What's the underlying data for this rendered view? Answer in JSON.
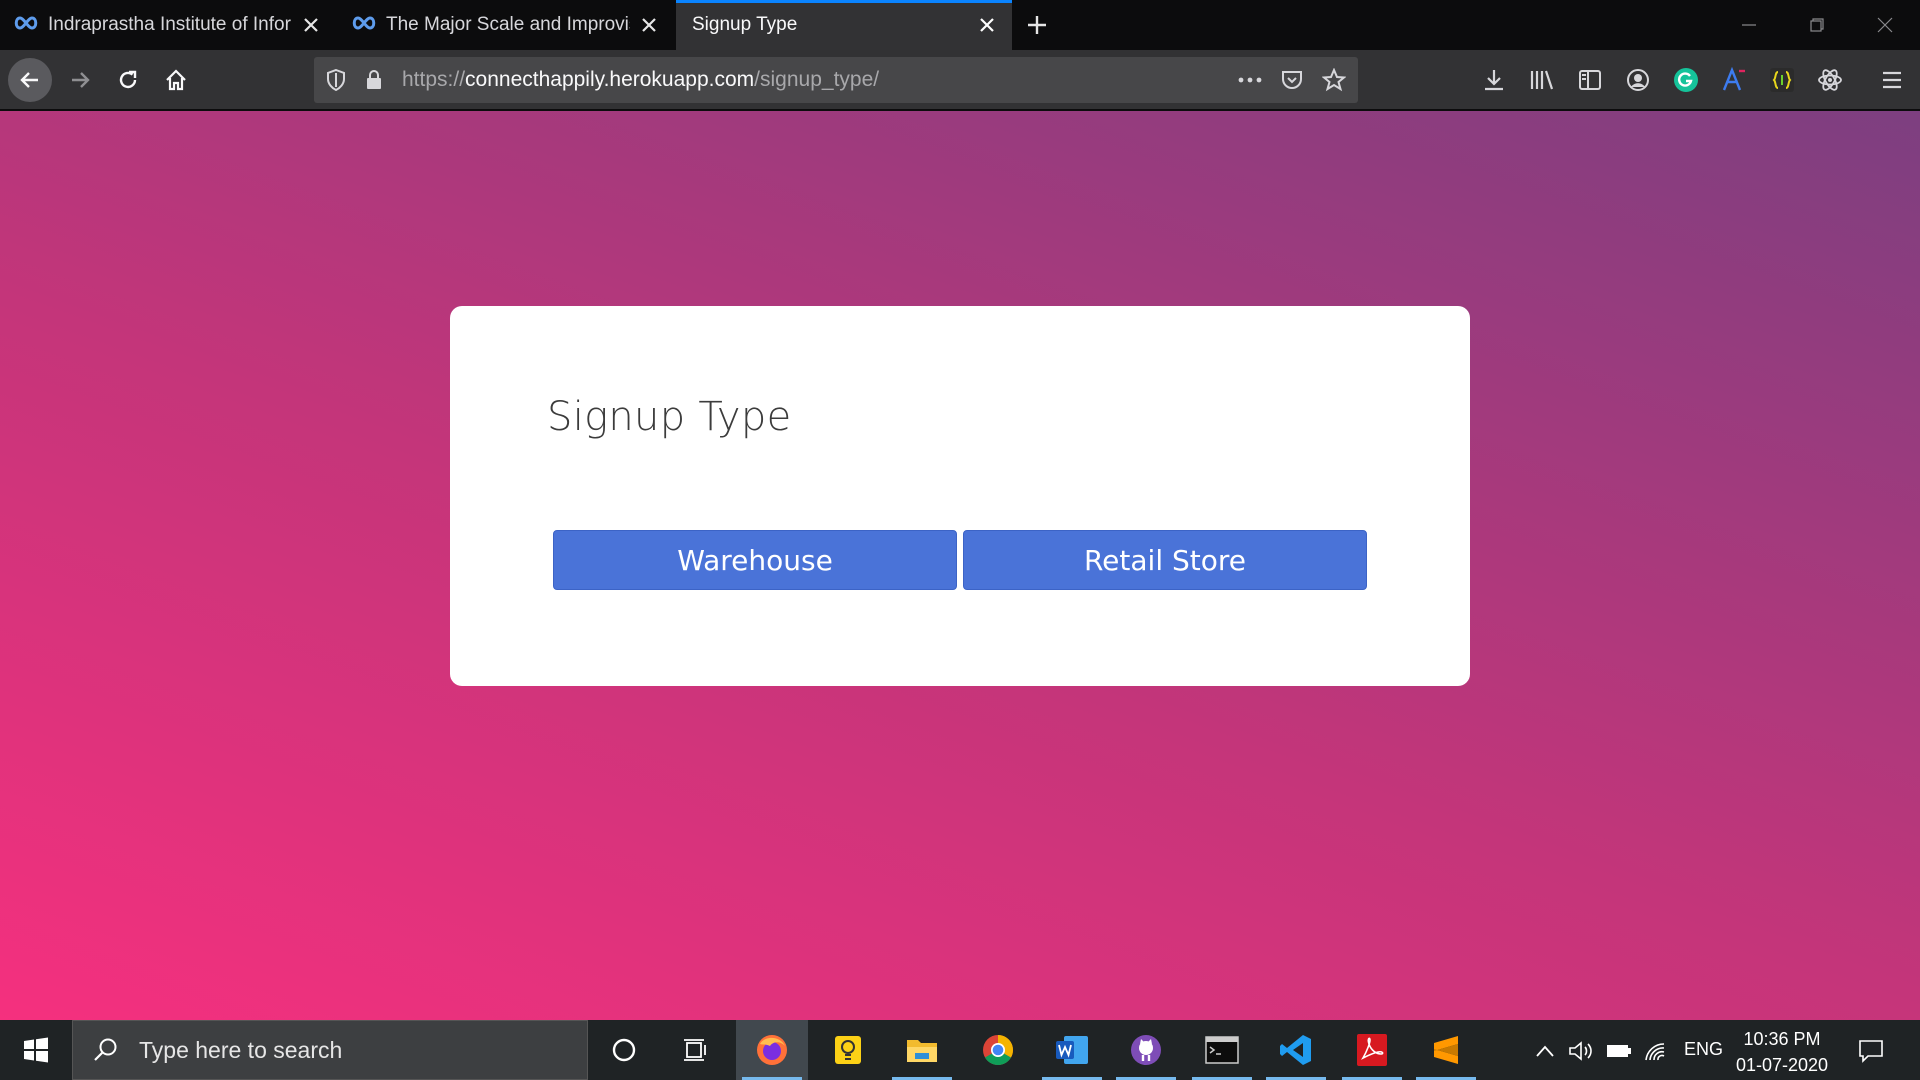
{
  "browser": {
    "tabs": [
      {
        "title": "Indraprastha Institute of Inform",
        "icon": "infinity-icon"
      },
      {
        "title": "The Major Scale and Improvisin",
        "icon": "infinity-icon"
      },
      {
        "title": "Signup Type",
        "icon": "none"
      }
    ],
    "active_tab": 2,
    "url": {
      "scheme": "https://",
      "host": "connecthappily.herokuapp.com",
      "path": "/signup_type/"
    },
    "accent": "#0a84ff"
  },
  "page": {
    "title": "Signup Type",
    "buttons": {
      "warehouse": "Warehouse",
      "retail": "Retail Store"
    },
    "button_color": "#4a73d8",
    "gradient": [
      "#f5307e",
      "#c4357a",
      "#7d3f80"
    ]
  },
  "taskbar": {
    "search_placeholder": "Type here to search",
    "apps": [
      "cortana",
      "task-view",
      "firefox",
      "sticky-notes",
      "file-explorer",
      "chrome",
      "word",
      "github-desktop",
      "terminal",
      "vscode",
      "acrobat",
      "sublime-text"
    ],
    "language": "ENG",
    "time": "10:36 PM",
    "date": "01-07-2020"
  }
}
